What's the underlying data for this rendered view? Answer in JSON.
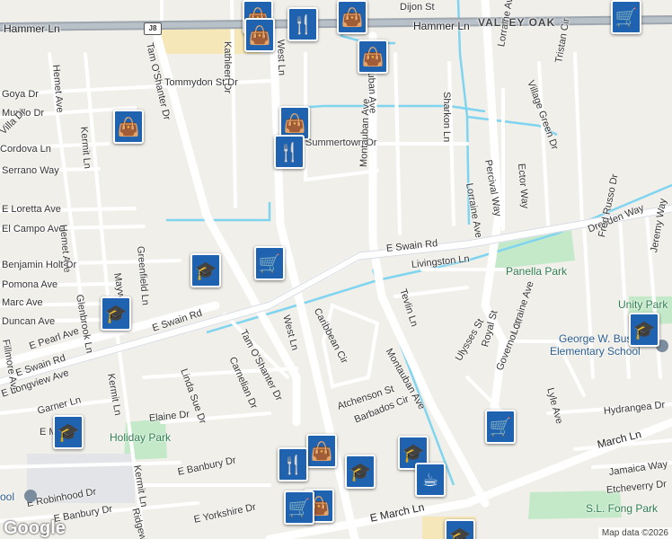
{
  "map": {
    "colors": {
      "land": "#f1efe9",
      "road": "#ffffff",
      "arterial": "#d6dbe3",
      "water": "#7fd4f0",
      "park": "#c4e9c9",
      "highway": "#9ea6b0",
      "poi": "#1f63b0"
    },
    "highway_shield": "J8",
    "streets": [
      {
        "id": "dijon",
        "text": "Dijon St"
      },
      {
        "id": "valley-oak",
        "text": "VALLEY OAK"
      },
      {
        "id": "hammer-left",
        "text": "Hammer Ln"
      },
      {
        "id": "hammer-right",
        "text": "Hammer Ln"
      },
      {
        "id": "tam-oshanter-dr",
        "text": "Tam O'Shanter Dr"
      },
      {
        "id": "kathleen",
        "text": "Kathleen Dr"
      },
      {
        "id": "west-ln-top",
        "text": "West Ln"
      },
      {
        "id": "tommydon",
        "text": "Tommydon St Dr"
      },
      {
        "id": "goya",
        "text": "Goya Dr"
      },
      {
        "id": "murillo",
        "text": "Murillo Dr"
      },
      {
        "id": "villa",
        "text": "Villa Dr"
      },
      {
        "id": "cordova",
        "text": "Cordova Ln"
      },
      {
        "id": "serrano",
        "text": "Serrano Way"
      },
      {
        "id": "hemet",
        "text": "Hemet Ave"
      },
      {
        "id": "kermit-top",
        "text": "Kermit Ln"
      },
      {
        "id": "sharkon",
        "text": "Sharkon Ln"
      },
      {
        "id": "lorraine-top",
        "text": "Lorraine Ave"
      },
      {
        "id": "village-green",
        "text": "Village Green Dr"
      },
      {
        "id": "tristan",
        "text": "Tristan Cir"
      },
      {
        "id": "summertown",
        "text": "Summertown Dr"
      },
      {
        "id": "percival",
        "text": "Percival Way"
      },
      {
        "id": "ector",
        "text": "Ector Way"
      },
      {
        "id": "montauban-top",
        "text": "Montauban Ave"
      },
      {
        "id": "montauban-upper",
        "text": "Montauban Ave"
      },
      {
        "id": "lorraine-mid",
        "text": "Lorraine Ave"
      },
      {
        "id": "dresden",
        "text": "Dresden Way"
      },
      {
        "id": "loretta",
        "text": "E Loretta Ave"
      },
      {
        "id": "el-campo",
        "text": "El Campo Ave"
      },
      {
        "id": "greenfield",
        "text": "Greenfield Ln"
      },
      {
        "id": "hemet-2",
        "text": "Hemet Ave"
      },
      {
        "id": "benjamin",
        "text": "Benjamin Holt Dr"
      },
      {
        "id": "maywood",
        "text": "Maywood Ln"
      },
      {
        "id": "pomona",
        "text": "Pomona Ave"
      },
      {
        "id": "glenbrook",
        "text": "Glenbrook Ln"
      },
      {
        "id": "marc",
        "text": "Marc Ave"
      },
      {
        "id": "duncan",
        "text": "Duncan Ave"
      },
      {
        "id": "fillmore",
        "text": "Fillmore Ave"
      },
      {
        "id": "e-swain-right",
        "text": "E Swain Rd"
      },
      {
        "id": "livingston",
        "text": "Livingston Ln"
      },
      {
        "id": "fred-russo",
        "text": "Fred Russo Dr"
      },
      {
        "id": "jeremy",
        "text": "Jeremy Way"
      },
      {
        "id": "e-swain-mid",
        "text": "E Swain Rd"
      },
      {
        "id": "e-swain-left",
        "text": "E Swain Rd"
      },
      {
        "id": "e-pearl",
        "text": "E Pearl Ave"
      },
      {
        "id": "west-ln-mid",
        "text": "West Ln"
      },
      {
        "id": "caribbean",
        "text": "Caribbean Cir"
      },
      {
        "id": "tam-oshanter-lower",
        "text": "Tam O'Shanter Dr"
      },
      {
        "id": "camelian",
        "text": "Carnelian Dr"
      },
      {
        "id": "tevlin",
        "text": "Tevlin Ln"
      },
      {
        "id": "e-longview",
        "text": "E Longview Ave"
      },
      {
        "id": "kermit-low",
        "text": "Kermit Ln"
      },
      {
        "id": "linda-sue",
        "text": "Linda Sue Dr"
      },
      {
        "id": "montauban-low",
        "text": "Montauban Ave"
      },
      {
        "id": "ulysses",
        "text": "Ulysses St"
      },
      {
        "id": "royal",
        "text": "Royal St"
      },
      {
        "id": "governor",
        "text": "Governor Cir"
      },
      {
        "id": "lorraine-low",
        "text": "Lorraine Ave"
      },
      {
        "id": "lyle",
        "text": "Lyle Ave"
      },
      {
        "id": "hydrangea",
        "text": "Hydrangea Dr"
      },
      {
        "id": "garner",
        "text": "Garner Ln"
      },
      {
        "id": "elaine",
        "text": "Elaine Dr"
      },
      {
        "id": "atchenson",
        "text": "Atchenson St"
      },
      {
        "id": "barbados",
        "text": "Barbados Cir"
      },
      {
        "id": "e-mc",
        "text": "E Mc"
      },
      {
        "id": "march-ln",
        "text": "March Ln"
      },
      {
        "id": "jamaica",
        "text": "Jamaica Way"
      },
      {
        "id": "etcheverry",
        "text": "Etcheverry Dr"
      },
      {
        "id": "e-banbury",
        "text": "E Banbury Dr"
      },
      {
        "id": "kermit-bot",
        "text": "Kermit Ln"
      },
      {
        "id": "e-robinhood",
        "text": "E Robinhood Dr"
      },
      {
        "id": "e-banbury-2",
        "text": "E Banbury Dr"
      },
      {
        "id": "ridgeway",
        "text": "Ridgeway"
      },
      {
        "id": "e-yorkshire",
        "text": "E Yorkshire Dr"
      },
      {
        "id": "e-march",
        "text": "E March Ln"
      }
    ],
    "parks": [
      {
        "id": "panella",
        "text": "Panella Park"
      },
      {
        "id": "holiday",
        "text": "Holiday Park"
      },
      {
        "id": "sl-fong",
        "text": "S.L. Fong Park"
      },
      {
        "id": "unity",
        "text": "Unity Park"
      }
    ],
    "schools": [
      {
        "id": "george-w-bush",
        "text": "George W. Bush"
      },
      {
        "id": "elementary",
        "text": "Elementary School"
      },
      {
        "id": "school-left",
        "text": "ool"
      }
    ],
    "google_logo": "Google",
    "attribution": "Map data ©2026"
  }
}
